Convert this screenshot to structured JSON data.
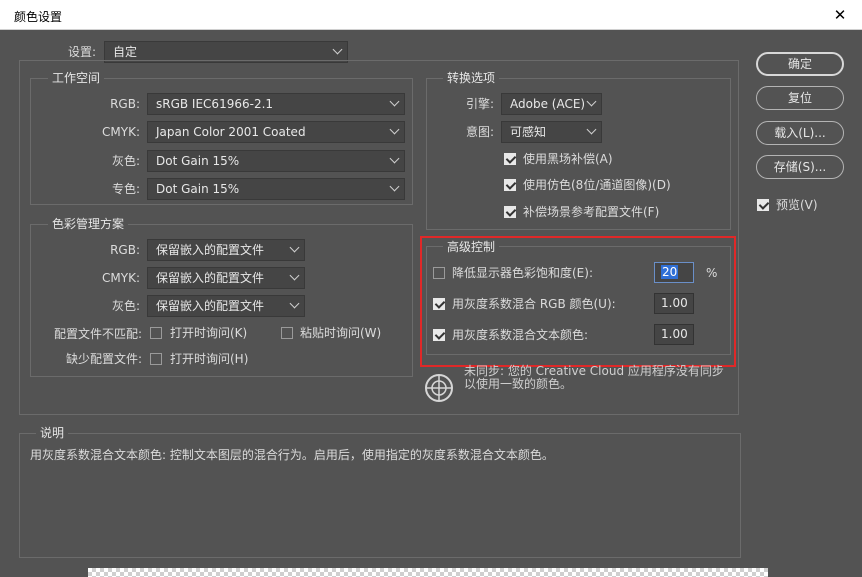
{
  "window": {
    "title": "颜色设置",
    "close_glyph": "✕"
  },
  "settings": {
    "label": "设置:",
    "value": "自定"
  },
  "working_spaces": {
    "title": "工作空间",
    "rows": [
      {
        "label": "RGB:",
        "value": "sRGB IEC61966-2.1"
      },
      {
        "label": "CMYK:",
        "value": "Japan Color 2001 Coated"
      },
      {
        "label": "灰色:",
        "value": "Dot Gain 15%"
      },
      {
        "label": "专色:",
        "value": "Dot Gain 15%"
      }
    ]
  },
  "color_management": {
    "title": "色彩管理方案",
    "rows": [
      {
        "label": "RGB:",
        "value": "保留嵌入的配置文件"
      },
      {
        "label": "CMYK:",
        "value": "保留嵌入的配置文件"
      },
      {
        "label": "灰色:",
        "value": "保留嵌入的配置文件"
      }
    ],
    "mismatch": {
      "label": "配置文件不匹配:",
      "opt1": "打开时询问(K)",
      "opt1_checked": false,
      "opt2": "粘贴时询问(W)",
      "opt2_checked": false
    },
    "missing": {
      "label": "缺少配置文件:",
      "opt1": "打开时询问(H)",
      "opt1_checked": false
    }
  },
  "conversion": {
    "title": "转换选项",
    "engine_label": "引擎:",
    "engine_value": "Adobe (ACE)",
    "intent_label": "意图:",
    "intent_value": "可感知",
    "checks": [
      {
        "label": "使用黑场补偿(A)",
        "checked": true
      },
      {
        "label": "使用仿色(8位/通道图像)(D)",
        "checked": true
      },
      {
        "label": "补偿场景参考配置文件(F)",
        "checked": true
      }
    ]
  },
  "advanced": {
    "title": "高级控制",
    "desaturate": {
      "label": "降低显示器色彩饱和度(E):",
      "checked": false,
      "value": "20",
      "unit": "%"
    },
    "blend_rgb": {
      "label": "用灰度系数混合 RGB 颜色(U):",
      "checked": true,
      "value": "1.00"
    },
    "blend_text": {
      "label": "用灰度系数混合文本颜色:",
      "checked": true,
      "value": "1.00"
    }
  },
  "sync_note": {
    "text": "未同步: 您的 Creative Cloud 应用程序没有同步以使用一致的颜色。"
  },
  "buttons": {
    "ok": "确定",
    "reset": "复位",
    "load": "载入(L)...",
    "save": "存储(S)...",
    "preview": "预览(V)",
    "preview_checked": true
  },
  "description": {
    "title": "说明",
    "text": "用灰度系数混合文本颜色: 控制文本图层的混合行为。启用后，使用指定的灰度系数混合文本颜色。"
  },
  "colors": {
    "dialog_bg": "#535353",
    "highlight_box": "#e02828",
    "selection": "#2f6fd6"
  }
}
